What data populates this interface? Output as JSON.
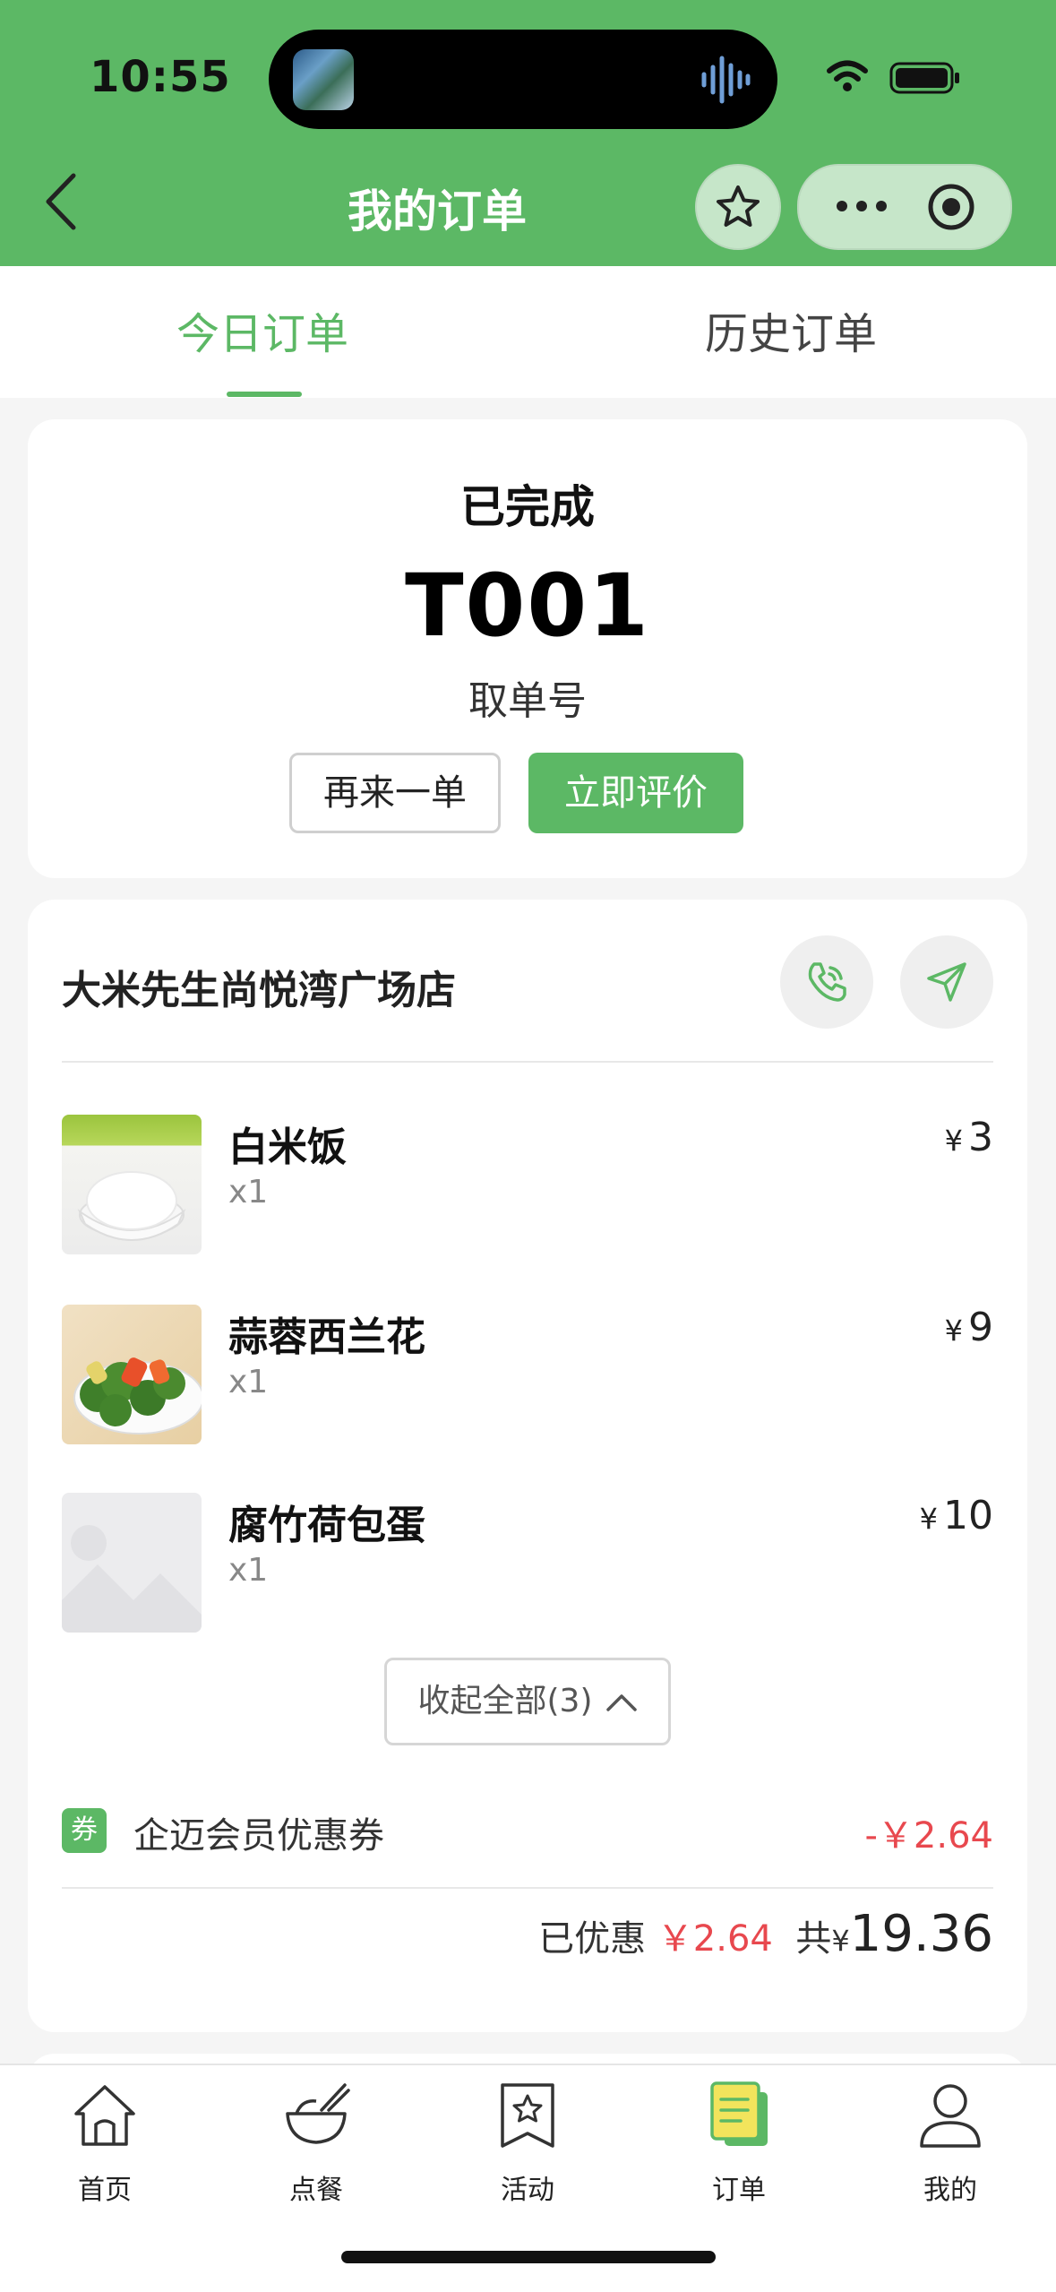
{
  "status_bar": {
    "time": "10:55"
  },
  "header": {
    "title": "我的订单"
  },
  "tabs": [
    {
      "label": "今日订单",
      "active": true
    },
    {
      "label": "历史订单",
      "active": false
    }
  ],
  "order": {
    "status": "已完成",
    "number": "T001",
    "number_label": "取单号",
    "reorder_label": "再来一单",
    "review_label": "立即评价"
  },
  "store": {
    "name": "大米先生尚悦湾广场店",
    "items": [
      {
        "name": "白米饭",
        "qty": "x1",
        "currency": "¥",
        "price": "3"
      },
      {
        "name": "蒜蓉西兰花",
        "qty": "x1",
        "currency": "¥",
        "price": "9"
      },
      {
        "name": "腐竹荷包蛋",
        "qty": "x1",
        "currency": "¥",
        "price": "10"
      }
    ],
    "collapse_label": "收起全部(3)",
    "coupon": {
      "badge": "券",
      "label": "企迈会员优惠券",
      "amount": "-￥2.64"
    },
    "summary": {
      "discount_label": "已优惠",
      "discount_amount": "￥2.64",
      "total_label": "共",
      "currency": "¥",
      "total": "19.36"
    }
  },
  "bottom_nav": [
    {
      "label": "首页",
      "icon": "home-icon",
      "active": false
    },
    {
      "label": "点餐",
      "icon": "bowl-icon",
      "active": false
    },
    {
      "label": "活动",
      "icon": "star-bookmark-icon",
      "active": false
    },
    {
      "label": "订单",
      "icon": "order-doc-icon",
      "active": true
    },
    {
      "label": "我的",
      "icon": "user-icon",
      "active": false
    }
  ],
  "colors": {
    "brand_green": "#5cb865",
    "discount_red": "#e8484e"
  }
}
